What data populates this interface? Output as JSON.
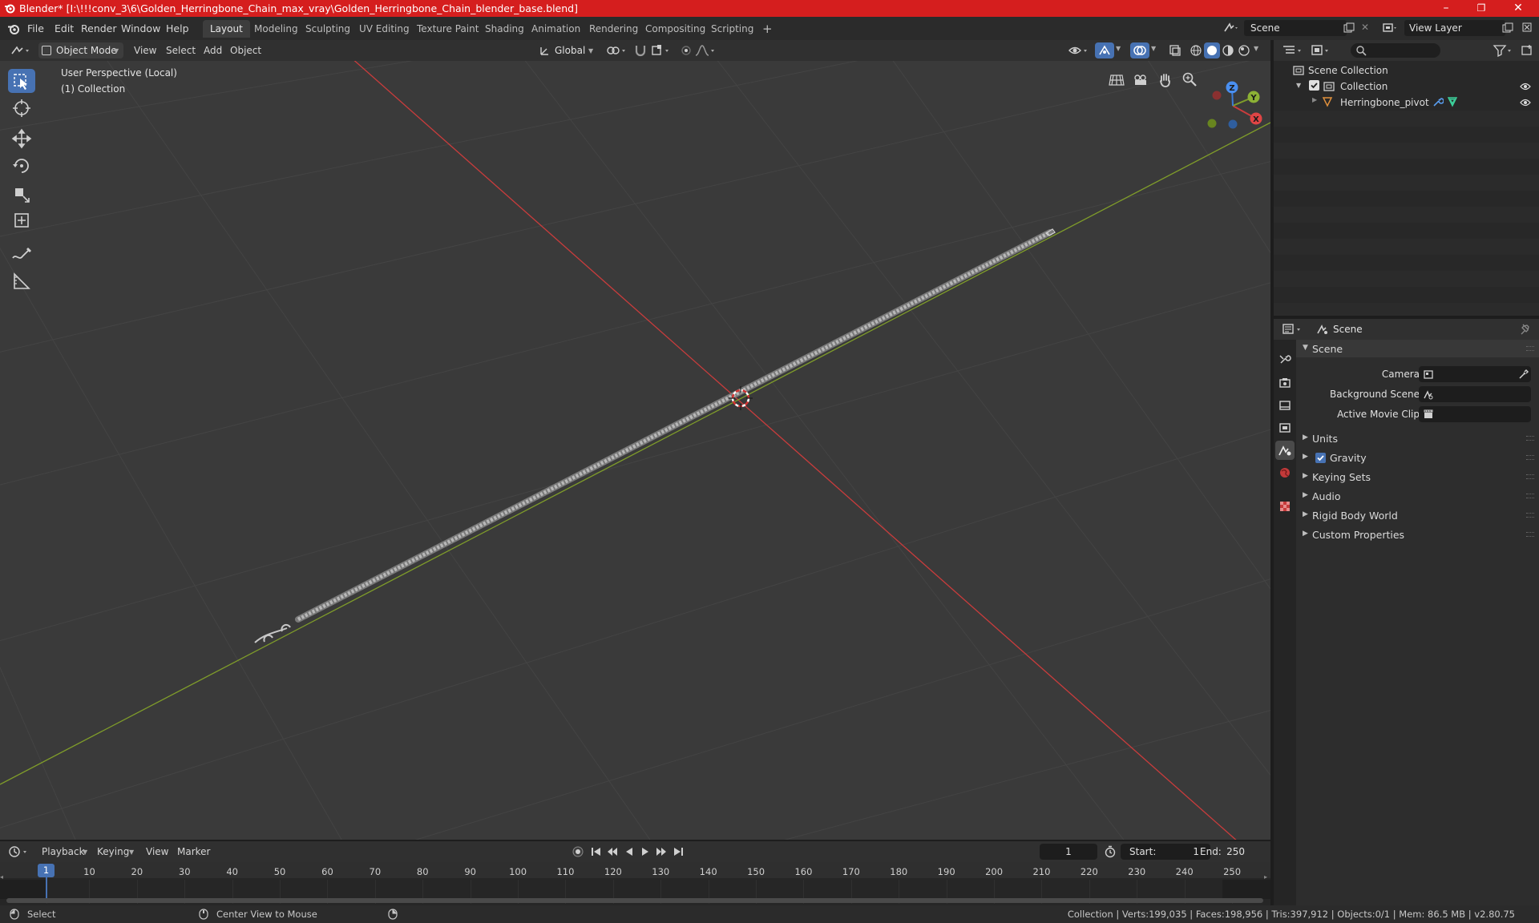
{
  "window": {
    "title": "Blender* [I:\\!!!conv_3\\6\\Golden_Herringbone_Chain_max_vray\\Golden_Herringbone_Chain_blender_base.blend]",
    "controls": {
      "minimize": "–",
      "restore": "❐",
      "close": "✕"
    }
  },
  "menubar": {
    "menus": [
      "File",
      "Edit",
      "Render",
      "Window",
      "Help"
    ],
    "workspaces": [
      "Layout",
      "Modeling",
      "Sculpting",
      "UV Editing",
      "Texture Paint",
      "Shading",
      "Animation",
      "Rendering",
      "Compositing",
      "Scripting"
    ],
    "add_workspace": "+",
    "scene_name": "Scene",
    "view_layer": "View Layer"
  },
  "viewport_header": {
    "mode": "Object Mode",
    "menus": [
      "View",
      "Select",
      "Add",
      "Object"
    ],
    "transform_orientation": "Global"
  },
  "viewport": {
    "perspective": "User Perspective (Local)",
    "collection": "(1) Collection",
    "gizmo": {
      "x": "X",
      "y": "Y",
      "z": "Z"
    }
  },
  "outliner": {
    "root": "Scene Collection",
    "collection": "Collection",
    "object": "Herringbone_pivot"
  },
  "properties": {
    "context": "Scene",
    "panel_title": "Scene",
    "fields": [
      {
        "label": "Camera",
        "value": ""
      },
      {
        "label": "Background Scene",
        "value": ""
      },
      {
        "label": "Active Movie Clip",
        "value": ""
      }
    ],
    "sections": [
      {
        "label": "Units",
        "checkbox": false
      },
      {
        "label": "Gravity",
        "checkbox": true
      },
      {
        "label": "Keying Sets",
        "checkbox": false
      },
      {
        "label": "Audio",
        "checkbox": false
      },
      {
        "label": "Rigid Body World",
        "checkbox": false
      },
      {
        "label": "Custom Properties",
        "checkbox": false
      }
    ]
  },
  "timeline": {
    "menus": [
      "Playback",
      "Keying",
      "View",
      "Marker"
    ],
    "current_frame": "1",
    "start_label": "Start:",
    "start": "1",
    "end_label": "End:",
    "end": "250",
    "ruler": [
      1,
      10,
      20,
      30,
      40,
      50,
      60,
      70,
      80,
      90,
      100,
      110,
      120,
      130,
      140,
      150,
      160,
      170,
      180,
      190,
      200,
      210,
      220,
      230,
      240,
      250
    ]
  },
  "statusbar": {
    "select": "Select",
    "center_view": "Center View to Mouse",
    "stats": "Collection | Verts:199,035 | Faces:198,956 | Tris:397,912 | Objects:0/1 | Mem: 86.5 MB | v2.80.75"
  },
  "colors": {
    "title_bar": "#d51e1e",
    "accent": "#4772b3",
    "x_axis": "#c93c3c",
    "y_axis": "#7f9c2a",
    "viewport_bg": "#3a3a3a"
  }
}
